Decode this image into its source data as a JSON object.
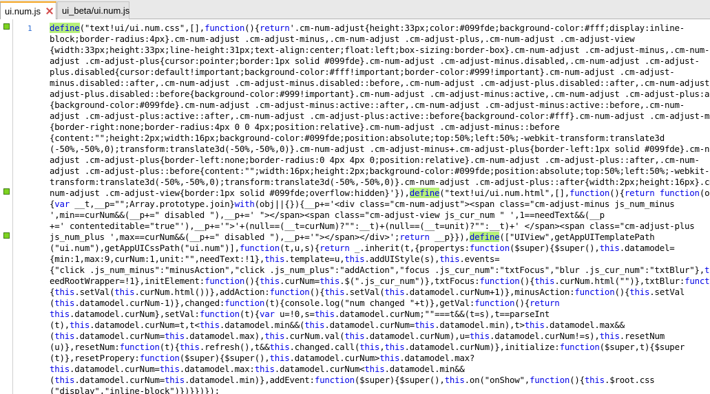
{
  "tabs": [
    {
      "label": "ui.num.js",
      "active": true
    },
    {
      "label": "ui_beta/ui.num.js",
      "active": false
    }
  ],
  "editor": {
    "line_number": "1",
    "lines": [
      [
        [
          "hl",
          "define"
        ],
        [
          "n",
          "(\"text!ui/ui.num.css\",[],"
        ],
        [
          "k",
          "function"
        ],
        [
          "n",
          "(){"
        ],
        [
          "k",
          "return"
        ],
        [
          "n",
          "'.cm-num-adjust{height:33px;color:#099fde;background-color:#fff;display:inline-"
        ]
      ],
      [
        [
          "n",
          "block;border-radius:4px}.cm-num-adjust .cm-adjust-minus,.cm-num-adjust .cm-adjust-plus,.cm-num-adjust .cm-adjust-view"
        ]
      ],
      [
        [
          "n",
          "{width:33px;height:33px;line-height:31px;text-align:center;float:left;box-sizing:border-box}.cm-num-adjust .cm-adjust-minus,.cm-num-"
        ]
      ],
      [
        [
          "n",
          "adjust .cm-adjust-plus{cursor:pointer;border:1px solid #099fde}.cm-num-adjust .cm-adjust-minus.disabled,.cm-num-adjust .cm-adjust-"
        ]
      ],
      [
        [
          "n",
          "plus.disabled{cursor:default!important;background-color:#fff!important;border-color:#999!important}.cm-num-adjust .cm-adjust-"
        ]
      ],
      [
        [
          "n",
          "minus.disabled::after,.cm-num-adjust .cm-adjust-minus.disabled::before,.cm-num-adjust .cm-adjust-plus.disabled::after,.cm-num-adjust .cm-"
        ]
      ],
      [
        [
          "n",
          "adjust-plus.disabled::before{background-color:#999!important}.cm-num-adjust .cm-adjust-minus:active,.cm-num-adjust .cm-adjust-plus:active"
        ]
      ],
      [
        [
          "n",
          "{background-color:#099fde}.cm-num-adjust .cm-adjust-minus:active::after,.cm-num-adjust .cm-adjust-minus:active::before,.cm-num-"
        ]
      ],
      [
        [
          "n",
          "adjust .cm-adjust-plus:active::after,.cm-num-adjust .cm-adjust-plus:active::before{background-color:#fff}.cm-num-adjust .cm-adjust-minus"
        ]
      ],
      [
        [
          "n",
          "{border-right:none;border-radius:4px 0 0 4px;position:relative}.cm-num-adjust .cm-adjust-minus::before"
        ]
      ],
      [
        [
          "n",
          "{content:\"\";height:2px;width:16px;background-color:#099fde;position:absolute;top:50%;left:50%;-webkit-transform:translate3d"
        ]
      ],
      [
        [
          "n",
          "(-50%,-50%,0);transform:translate3d(-50%,-50%,0)}.cm-num-adjust .cm-adjust-minus+.cm-adjust-plus{border-left:1px solid #099fde}.cm-num-"
        ]
      ],
      [
        [
          "n",
          "adjust .cm-adjust-plus{border-left:none;border-radius:0 4px 4px 0;position:relative}.cm-num-adjust .cm-adjust-plus::after,.cm-num-"
        ]
      ],
      [
        [
          "n",
          "adjust .cm-adjust-plus::before{content:\"\";width:16px;height:2px;background-color:#099fde;position:absolute;top:50%;left:50%;-webkit-"
        ]
      ],
      [
        [
          "n",
          "transform:translate3d(-50%,-50%,0);transform:translate3d(-50%,-50%,0)}.cm-num-adjust .cm-adjust-plus::after{width:2px;height:16px}.cm-"
        ]
      ],
      [
        [
          "n",
          "num-adjust .cm-adjust-view{border:1px solid #099fde;overflow:hidden}'}),"
        ],
        [
          "hl",
          "define"
        ],
        [
          "n",
          "(\"text!ui/ui.num.html\",[],"
        ],
        [
          "k",
          "function"
        ],
        [
          "n",
          "(){"
        ],
        [
          "k",
          "return function"
        ],
        [
          "n",
          "(obj)"
        ]
      ],
      [
        [
          "n",
          "{"
        ],
        [
          "k",
          "var"
        ],
        [
          "n",
          " __t,__p=\"\";Array.prototype.join}"
        ],
        [
          "k",
          "with"
        ],
        [
          "n",
          "(obj||{}){__p+='<div class=\"cm-num-adjust\"><span class=\"cm-adjust-minus js_num_minus"
        ]
      ],
      [
        [
          "n",
          "',min==curNum&&(__p+=\" disabled \"),__p+=' \"></span><span class=\"cm-adjust-view js_cur_num \" ',1==needText&&(__p"
        ]
      ],
      [
        [
          "n",
          "+=' contenteditable=\"true\"'),__p+='\">'+(null==(__t=curNum)?\"\":__t)+(null==(__t=unit)?\"\":__t)+' </span><span class=\"cm-adjust-plus"
        ]
      ],
      [
        [
          "n",
          "js_num_plus ',max==curNum&&(__p+=\" disabled \"),__p+='\"></span></div>';"
        ],
        [
          "k",
          "return"
        ],
        [
          "n",
          " __p}}),"
        ],
        [
          "hl",
          "define"
        ],
        [
          "n",
          "([\"UIView\",getAppUITemplatePath"
        ]
      ],
      [
        [
          "n",
          "(\"ui.num\"),getAppUICssPath(\"ui.num\")],"
        ],
        [
          "k",
          "function"
        ],
        [
          "n",
          "(t,u,s){"
        ],
        [
          "k",
          "return"
        ],
        [
          "n",
          " _.inherit(t,{propertys:"
        ],
        [
          "k",
          "function"
        ],
        [
          "n",
          "($super){$super(),"
        ],
        [
          "k",
          "this"
        ],
        [
          "n",
          ".datamodel="
        ]
      ],
      [
        [
          "n",
          "{min:1,max:9,curNum:1,unit:\"\",needText:!1},"
        ],
        [
          "k",
          "this"
        ],
        [
          "n",
          ".template=u,"
        ],
        [
          "k",
          "this"
        ],
        [
          "n",
          ".addUIStyle(s),"
        ],
        [
          "k",
          "this"
        ],
        [
          "n",
          ".events="
        ]
      ],
      [
        [
          "n",
          "{\"click .js_num_minus\":\"minusAction\",\"click .js_num_plus\":\"addAction\",\"focus .js_cur_num\":\"txtFocus\",\"blur .js_cur_num\":\"txtBlur\"},"
        ],
        [
          "k",
          "this"
        ],
        [
          "n",
          ".n"
        ]
      ],
      [
        [
          "n",
          "eedRootWrapper=!1},initElement:"
        ],
        [
          "k",
          "function"
        ],
        [
          "n",
          "(){"
        ],
        [
          "k",
          "this"
        ],
        [
          "n",
          ".curNum="
        ],
        [
          "k",
          "this"
        ],
        [
          "n",
          ".$(\".js_cur_num\")},txtFocus:"
        ],
        [
          "k",
          "function"
        ],
        [
          "n",
          "(){"
        ],
        [
          "k",
          "this"
        ],
        [
          "n",
          ".curNum.html(\"\")},txtBlur:"
        ],
        [
          "k",
          "function"
        ],
        [
          "n",
          "()"
        ]
      ],
      [
        [
          "n",
          "{"
        ],
        [
          "k",
          "this"
        ],
        [
          "n",
          ".setVal("
        ],
        [
          "k",
          "this"
        ],
        [
          "n",
          ".curNum.html())},addAction:"
        ],
        [
          "k",
          "function"
        ],
        [
          "n",
          "(){"
        ],
        [
          "k",
          "this"
        ],
        [
          "n",
          ".setVal("
        ],
        [
          "k",
          "this"
        ],
        [
          "n",
          ".datamodel.curNum+1)},minusAction:"
        ],
        [
          "k",
          "function"
        ],
        [
          "n",
          "(){"
        ],
        [
          "k",
          "this"
        ],
        [
          "n",
          ".setVal"
        ]
      ],
      [
        [
          "n",
          "("
        ],
        [
          "k",
          "this"
        ],
        [
          "n",
          ".datamodel.curNum-1)},changed:"
        ],
        [
          "k",
          "function"
        ],
        [
          "n",
          "(t){console.log(\"num changed \"+t)},getVal:"
        ],
        [
          "k",
          "function"
        ],
        [
          "n",
          "(){"
        ],
        [
          "k",
          "return"
        ]
      ],
      [
        [
          "k",
          "this"
        ],
        [
          "n",
          ".datamodel.curNum},setVal:"
        ],
        [
          "k",
          "function"
        ],
        [
          "n",
          "(t){"
        ],
        [
          "k",
          "var"
        ],
        [
          "n",
          " u=!0,s="
        ],
        [
          "k",
          "this"
        ],
        [
          "n",
          ".datamodel.curNum;\"\"===t&&(t=s),t==parseInt"
        ]
      ],
      [
        [
          "n",
          "(t),"
        ],
        [
          "k",
          "this"
        ],
        [
          "n",
          ".datamodel.curNum=t,t<"
        ],
        [
          "k",
          "this"
        ],
        [
          "n",
          ".datamodel.min&&("
        ],
        [
          "k",
          "this"
        ],
        [
          "n",
          ".datamodel.curNum="
        ],
        [
          "k",
          "this"
        ],
        [
          "n",
          ".datamodel.min),t>"
        ],
        [
          "k",
          "this"
        ],
        [
          "n",
          ".datamodel.max&&"
        ]
      ],
      [
        [
          "n",
          "("
        ],
        [
          "k",
          "this"
        ],
        [
          "n",
          ".datamodel.curNum="
        ],
        [
          "k",
          "this"
        ],
        [
          "n",
          ".datamodel.max),"
        ],
        [
          "k",
          "this"
        ],
        [
          "n",
          ".curNum.val("
        ],
        [
          "k",
          "this"
        ],
        [
          "n",
          ".datamodel.curNum),u="
        ],
        [
          "k",
          "this"
        ],
        [
          "n",
          ".datamodel.curNum!=s),"
        ],
        [
          "k",
          "this"
        ],
        [
          "n",
          ".resetNum"
        ]
      ],
      [
        [
          "n",
          "(u)},resetNum:"
        ],
        [
          "k",
          "function"
        ],
        [
          "n",
          "(t){"
        ],
        [
          "k",
          "this"
        ],
        [
          "n",
          ".refresh(),t&&"
        ],
        [
          "k",
          "this"
        ],
        [
          "n",
          ".changed.call("
        ],
        [
          "k",
          "this"
        ],
        [
          "n",
          ","
        ],
        [
          "k",
          "this"
        ],
        [
          "n",
          ".datamodel.curNum)},initialize:"
        ],
        [
          "k",
          "function"
        ],
        [
          "n",
          "($super,t){$super"
        ]
      ],
      [
        [
          "n",
          "(t)},resetPropery:"
        ],
        [
          "k",
          "function"
        ],
        [
          "n",
          "($super){$super(),"
        ],
        [
          "k",
          "this"
        ],
        [
          "n",
          ".datamodel.curNum>"
        ],
        [
          "k",
          "this"
        ],
        [
          "n",
          ".datamodel.max?"
        ]
      ],
      [
        [
          "k",
          "this"
        ],
        [
          "n",
          ".datamodel.curNum="
        ],
        [
          "k",
          "this"
        ],
        [
          "n",
          ".datamodel.max:"
        ],
        [
          "k",
          "this"
        ],
        [
          "n",
          ".datamodel.curNum<"
        ],
        [
          "k",
          "this"
        ],
        [
          "n",
          ".datamodel.min&&"
        ]
      ],
      [
        [
          "n",
          "("
        ],
        [
          "k",
          "this"
        ],
        [
          "n",
          ".datamodel.curNum="
        ],
        [
          "k",
          "this"
        ],
        [
          "n",
          ".datamodel.min)},addEvent:"
        ],
        [
          "k",
          "function"
        ],
        [
          "n",
          "($super){$super(),"
        ],
        [
          "k",
          "this"
        ],
        [
          "n",
          ".on(\"onShow\","
        ],
        [
          "k",
          "function"
        ],
        [
          "n",
          "(){"
        ],
        [
          "k",
          "this"
        ],
        [
          "n",
          ".$root.css"
        ]
      ],
      [
        [
          "n",
          "(\"display\",\"inline-block\")})}})});"
        ]
      ]
    ]
  }
}
